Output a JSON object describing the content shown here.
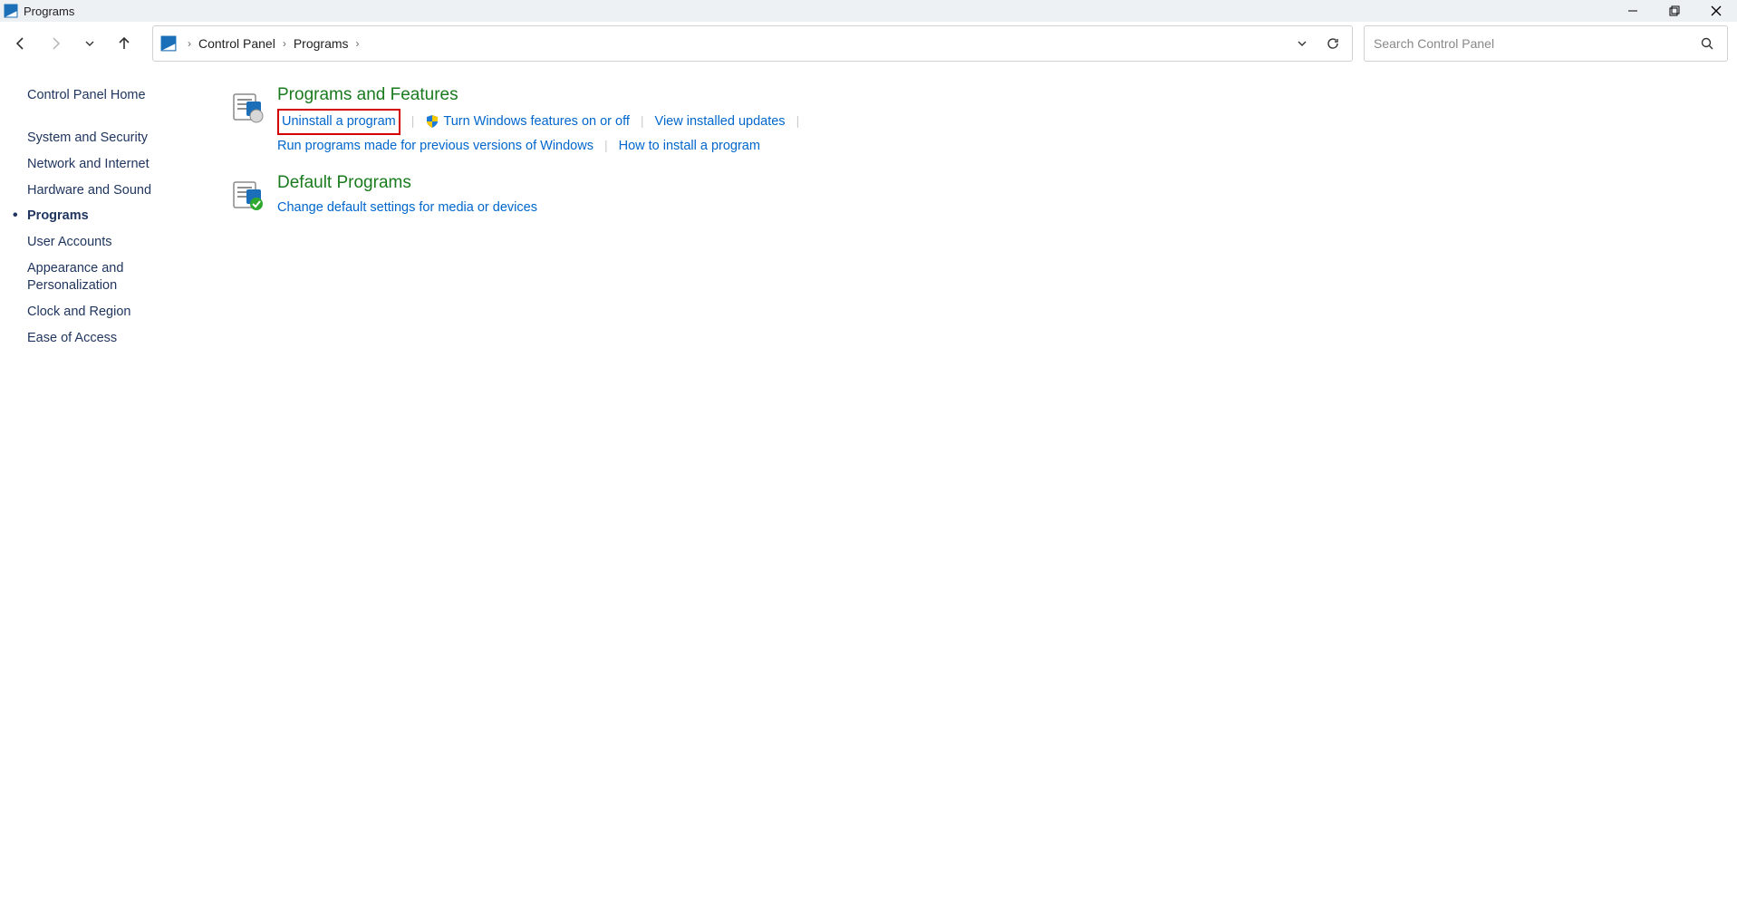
{
  "window": {
    "title": "Programs"
  },
  "breadcrumb": {
    "items": [
      "Control Panel",
      "Programs"
    ]
  },
  "search": {
    "placeholder": "Search Control Panel"
  },
  "sidebar": {
    "home": "Control Panel Home",
    "items": [
      "System and Security",
      "Network and Internet",
      "Hardware and Sound",
      "Programs",
      "User Accounts",
      "Appearance and Personalization",
      "Clock and Region",
      "Ease of Access"
    ],
    "active_index": 3
  },
  "categories": [
    {
      "title": "Programs and Features",
      "links": [
        {
          "label": "Uninstall a program",
          "highlighted": true
        },
        {
          "label": "Turn Windows features on or off",
          "shield": true
        },
        {
          "label": "View installed updates"
        },
        {
          "label": "Run programs made for previous versions of Windows"
        },
        {
          "label": "How to install a program"
        }
      ]
    },
    {
      "title": "Default Programs",
      "links": [
        {
          "label": "Change default settings for media or devices"
        }
      ]
    }
  ]
}
